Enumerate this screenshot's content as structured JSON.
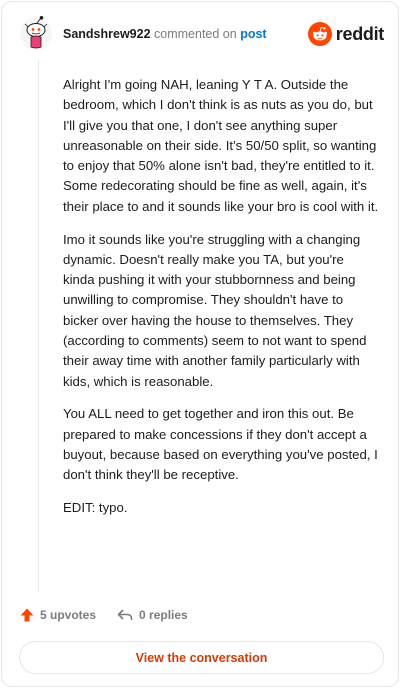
{
  "comment": {
    "username": "Sandshrew922",
    "action_text": "commented on",
    "post_link": "post",
    "brand": "reddit",
    "paragraphs": [
      "Alright I'm going NAH, leaning Y T A. Outside the bedroom, which I don't think is as nuts as you do, but I'll give you that one, I don't see anything super unreasonable on their side. It's 50/50 split, so wanting to enjoy that 50% alone isn't bad, they're entitled to it. Some redecorating should be fine as well, again, it's their place to and it sounds like your bro is cool with it.",
      "Imo it sounds like you're struggling with a changing dynamic. Doesn't really make you TA, but you're kinda pushing it with your stubbornness and being unwilling to compromise. They shouldn't have to bicker over having the house to themselves. They (according to comments) seem to not want to spend their away time with another family particularly with kids, which is reasonable.",
      "You ALL need to get together and iron this out. Be prepared to make concessions if they don't accept a buyout, because based on everything you've posted, I don't think they'll be receptive.",
      "EDIT: typo."
    ],
    "upvotes": "5 upvotes",
    "replies": "0 replies",
    "cta_label": "View the conversation"
  },
  "icons": {
    "avatar": "snoo-avatar-icon",
    "logo": "reddit-snoo-icon",
    "upvote": "upvote-arrow-icon",
    "reply": "reply-arrow-icon"
  },
  "colors": {
    "brand_orange": "#ff4500",
    "link_blue": "#0079d3",
    "cta_text": "#d93a00"
  }
}
